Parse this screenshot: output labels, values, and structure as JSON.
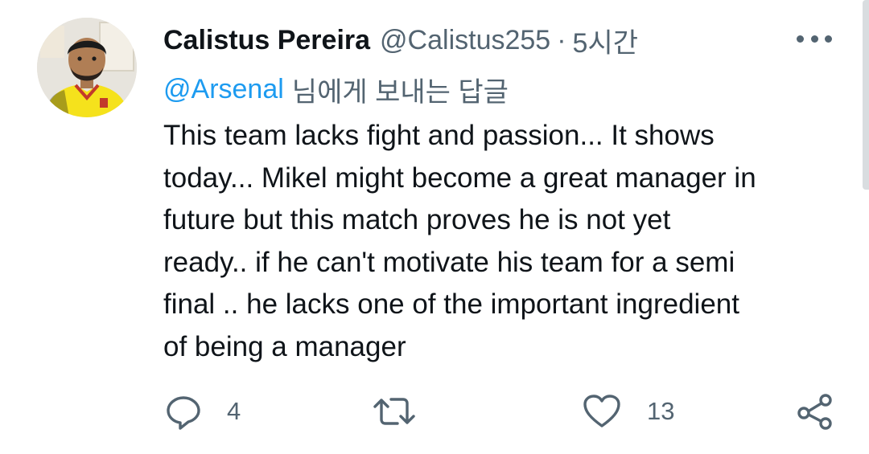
{
  "tweet": {
    "author_name": "Calistus Pereira",
    "author_handle": "@Calistus255",
    "separator": "·",
    "time": "5시간",
    "reply_mention": "@Arsenal",
    "reply_suffix": "님에게 보내는 답글",
    "text_lines": [
      "This team lacks fight and passion... It shows",
      "today... Mikel might become a great manager in",
      "future but this match proves he is not yet",
      "ready.. if he can't motivate his team for a semi",
      "final .. he lacks one of the important ingredient",
      "of being a manager"
    ]
  },
  "actions": {
    "reply_count": "4",
    "retweet_count": "",
    "like_count": "13",
    "icons": [
      "reply-icon",
      "retweet-icon",
      "like-icon",
      "share-icon"
    ]
  },
  "colors": {
    "link": "#1d9bf0",
    "muted": "#536471",
    "text": "#0f1419",
    "avatar_shirt": "#f5e21c"
  }
}
